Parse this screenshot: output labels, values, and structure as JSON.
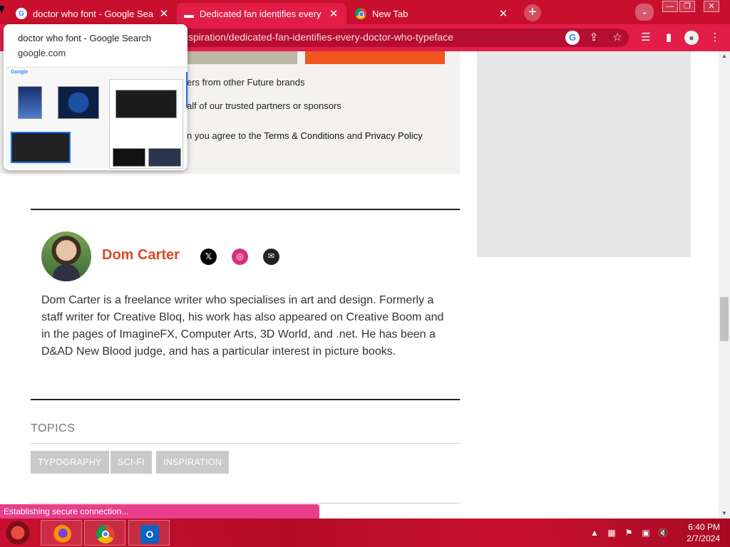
{
  "browser": {
    "tabs": [
      {
        "title": "doctor who font - Google Search",
        "favicon": "google-icon",
        "active": false
      },
      {
        "title": "Dedicated fan identifies every Do",
        "favicon": "creative-bloq-icon",
        "active": true
      },
      {
        "title": "New Tab",
        "favicon": "chrome-icon",
        "active": false
      }
    ],
    "url": "spiration/dedicated-fan-identifies-every-doctor-who-typeface",
    "accent_color": "#c8102e",
    "tab_hover_card": {
      "title": "doctor who font - Google Search",
      "domain": "google.com"
    }
  },
  "newsletter": {
    "line1": "ers from other Future brands",
    "line2": "alf of our trusted partners or sponsors",
    "line3_prefix": "n you agree to the ",
    "terms_link": "Terms & Conditions",
    "and_text": " and ",
    "privacy_link": "Privacy Policy",
    "submit_color": "#f0561d"
  },
  "author": {
    "name": "Dom Carter",
    "name_color": "#d84a27",
    "bio": "Dom Carter is a freelance writer who specialises in art and design. Formerly a staff writer for Creative Bloq, his work has also appeared on Creative Boom and in the pages of ImagineFX, Computer Arts, 3D World, and .net. He has been a D&AD New Blood judge, and has a particular interest in picture books.",
    "social_icons": [
      "x-icon",
      "instagram-icon",
      "email-icon"
    ]
  },
  "topics": {
    "heading": "TOPICS",
    "tags": [
      "TYPOGRAPHY",
      "SCI-FI",
      "INSPIRATION"
    ]
  },
  "status_bar": {
    "text": "Establishing secure connection..."
  },
  "taskbar": {
    "apps": [
      "firefox-icon",
      "chrome-icon",
      "outlook-icon"
    ],
    "time": "6:40 PM",
    "date": "2/7/2024"
  }
}
